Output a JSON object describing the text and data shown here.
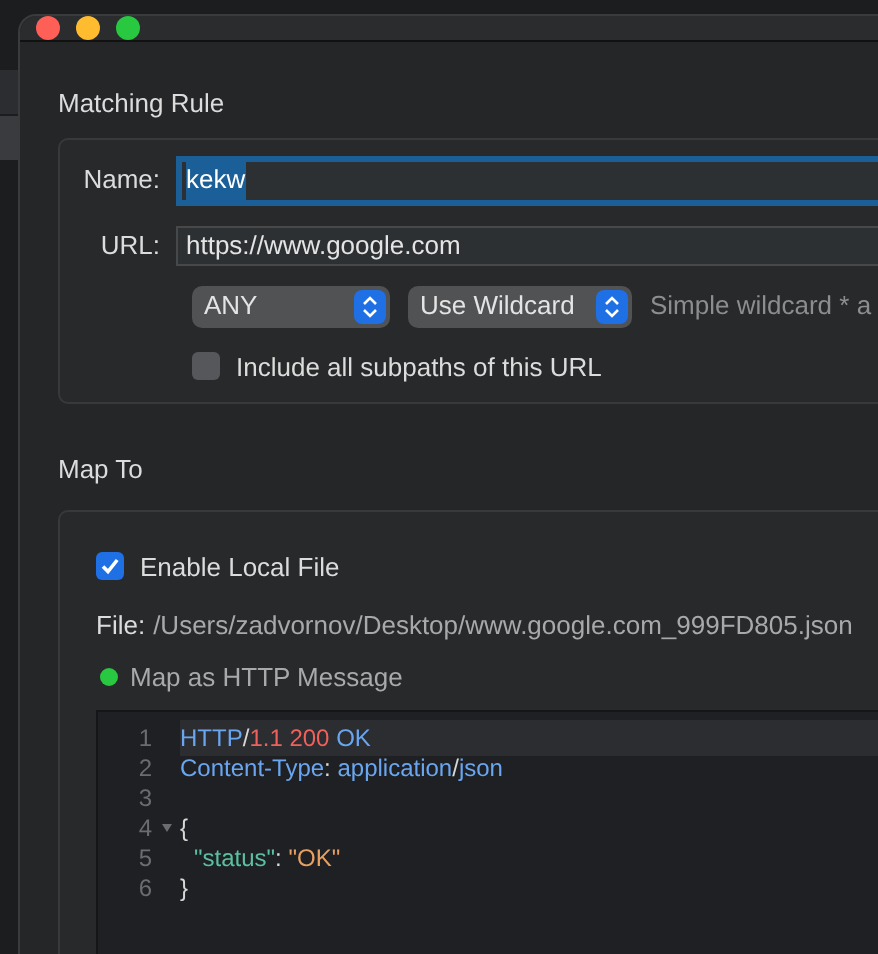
{
  "matching_rule": {
    "title": "Matching Rule",
    "name_label": "Name:",
    "name_value": "kekw",
    "url_label": "URL:",
    "url_value": "https://www.google.com",
    "method_select": "ANY",
    "match_select": "Use Wildcard",
    "match_hint": "Simple wildcard * a",
    "include_subpaths": {
      "label": "Include all subpaths of this URL",
      "checked": false
    }
  },
  "map_to": {
    "title": "Map To",
    "enable_local_file": {
      "label": "Enable Local File",
      "checked": true
    },
    "file_label": "File:",
    "file_path": "/Users/zadvornov/Desktop/www.google.com_999FD805.json",
    "status": {
      "label": "Map as HTTP Message",
      "color": "#28c840"
    },
    "editor": {
      "lines": [
        {
          "number": "1",
          "foldable": false,
          "indented": false,
          "tokens": [
            {
              "kind": "keyword",
              "text": "HTTP"
            },
            {
              "kind": "plain",
              "text": "/"
            },
            {
              "kind": "number",
              "text": "1.1 200"
            },
            {
              "kind": "keyword",
              "text": " OK"
            }
          ]
        },
        {
          "number": "2",
          "foldable": false,
          "indented": false,
          "tokens": [
            {
              "kind": "keyword",
              "text": "Content-Type"
            },
            {
              "kind": "plain",
              "text": ": "
            },
            {
              "kind": "keyword",
              "text": "application"
            },
            {
              "kind": "plain",
              "text": "/"
            },
            {
              "kind": "keyword",
              "text": "json"
            }
          ]
        },
        {
          "number": "3",
          "foldable": false
        },
        {
          "number": "4",
          "foldable": true,
          "indented": false,
          "tokens": [
            {
              "kind": "plain",
              "text": "{"
            }
          ]
        },
        {
          "number": "5",
          "foldable": false,
          "indented": true,
          "tokens": [
            {
              "kind": "key",
              "text": "\"status\""
            },
            {
              "kind": "plain",
              "text": ": "
            },
            {
              "kind": "string",
              "text": "\"OK\""
            }
          ]
        },
        {
          "number": "6",
          "foldable": false,
          "indented": false,
          "tokens": [
            {
              "kind": "plain",
              "text": "}"
            }
          ]
        }
      ]
    }
  }
}
